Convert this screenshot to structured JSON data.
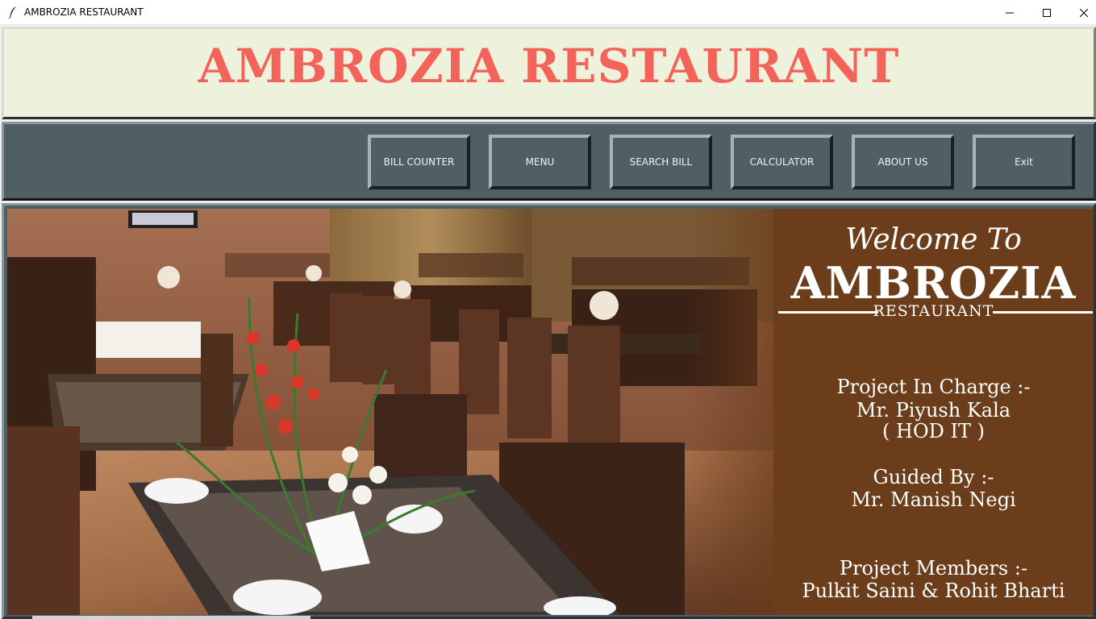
{
  "window": {
    "title": "AMBROZIA RESTAURANT",
    "icon": "feather-icon",
    "controls": {
      "minimize": "minimize-icon",
      "maximize": "maximize-icon",
      "close": "close-icon"
    }
  },
  "header": {
    "title": "AMBROZIA RESTAURANT"
  },
  "nav": {
    "buttons": [
      "BILL COUNTER",
      "MENU",
      "SEARCH BILL",
      "CALCULATOR",
      "ABOUT US",
      "Exit"
    ]
  },
  "banner": {
    "welcome": "Welcome To",
    "brand": "AMBROZIA",
    "brand_sub": "RESTAURANT",
    "project_in_charge_label": "Project In Charge :-",
    "project_in_charge_name": "Mr. Piyush Kala",
    "project_in_charge_role": "( HOD IT )",
    "guided_by_label": "Guided By :-",
    "guided_by_name": "Mr. Manish Negi",
    "members_label": "Project Members :-",
    "members_names": "Pulkit Saini & Rohit Bharti"
  },
  "colors": {
    "title_red": "#f36359",
    "header_bg": "#eef2dd",
    "nav_bg": "#505f64",
    "banner_brown": "#6b3d1b"
  }
}
